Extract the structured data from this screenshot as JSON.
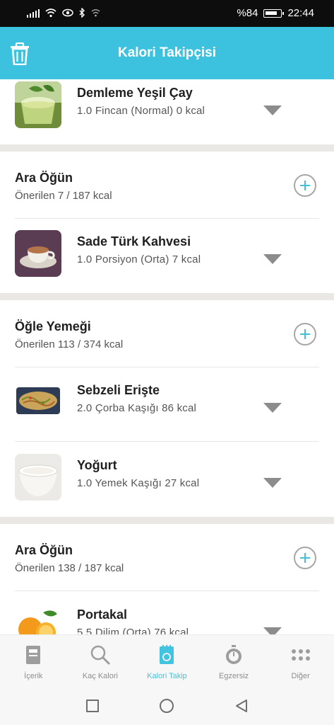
{
  "status_bar": {
    "battery": "%84",
    "time": "22:44"
  },
  "header": {
    "title": "Kalori Takipçisi",
    "icon": "trash-icon"
  },
  "sections": [
    {
      "items": [
        {
          "name": "Demleme Yeşil Çay",
          "detail": "1.0 Fincan (Normal) 0 kcal"
        }
      ]
    },
    {
      "title": "Ara Öğün",
      "subtitle": "Önerilen 7 / 187 kcal",
      "items": [
        {
          "name": "Sade Türk Kahvesi",
          "detail": "1.0 Porsiyon (Orta) 7 kcal"
        }
      ]
    },
    {
      "title": "Öğle Yemeği",
      "subtitle": "Önerilen 113 / 374 kcal",
      "items": [
        {
          "name": "Sebzeli Erişte",
          "detail": "2.0 Çorba Kaşığı 86 kcal"
        },
        {
          "name": "Yoğurt",
          "detail": "1.0 Yemek Kaşığı 27 kcal"
        }
      ]
    },
    {
      "title": "Ara Öğün",
      "subtitle": "Önerilen 138 / 187 kcal",
      "items": [
        {
          "name": "Portakal",
          "detail": "5.5 Dilim (Orta) 76 kcal"
        }
      ]
    }
  ],
  "bottom_nav": [
    {
      "label": "İçerik",
      "icon": "book-icon"
    },
    {
      "label": "Kaç Kalori",
      "icon": "search-icon"
    },
    {
      "label": "Kalori Takip",
      "icon": "tracker-icon",
      "active": true
    },
    {
      "label": "Egzersiz",
      "icon": "stopwatch-icon"
    },
    {
      "label": "Diğer",
      "icon": "more-dots-icon"
    }
  ],
  "colors": {
    "accent": "#3cc2de",
    "separator": "#e9e8e4"
  }
}
